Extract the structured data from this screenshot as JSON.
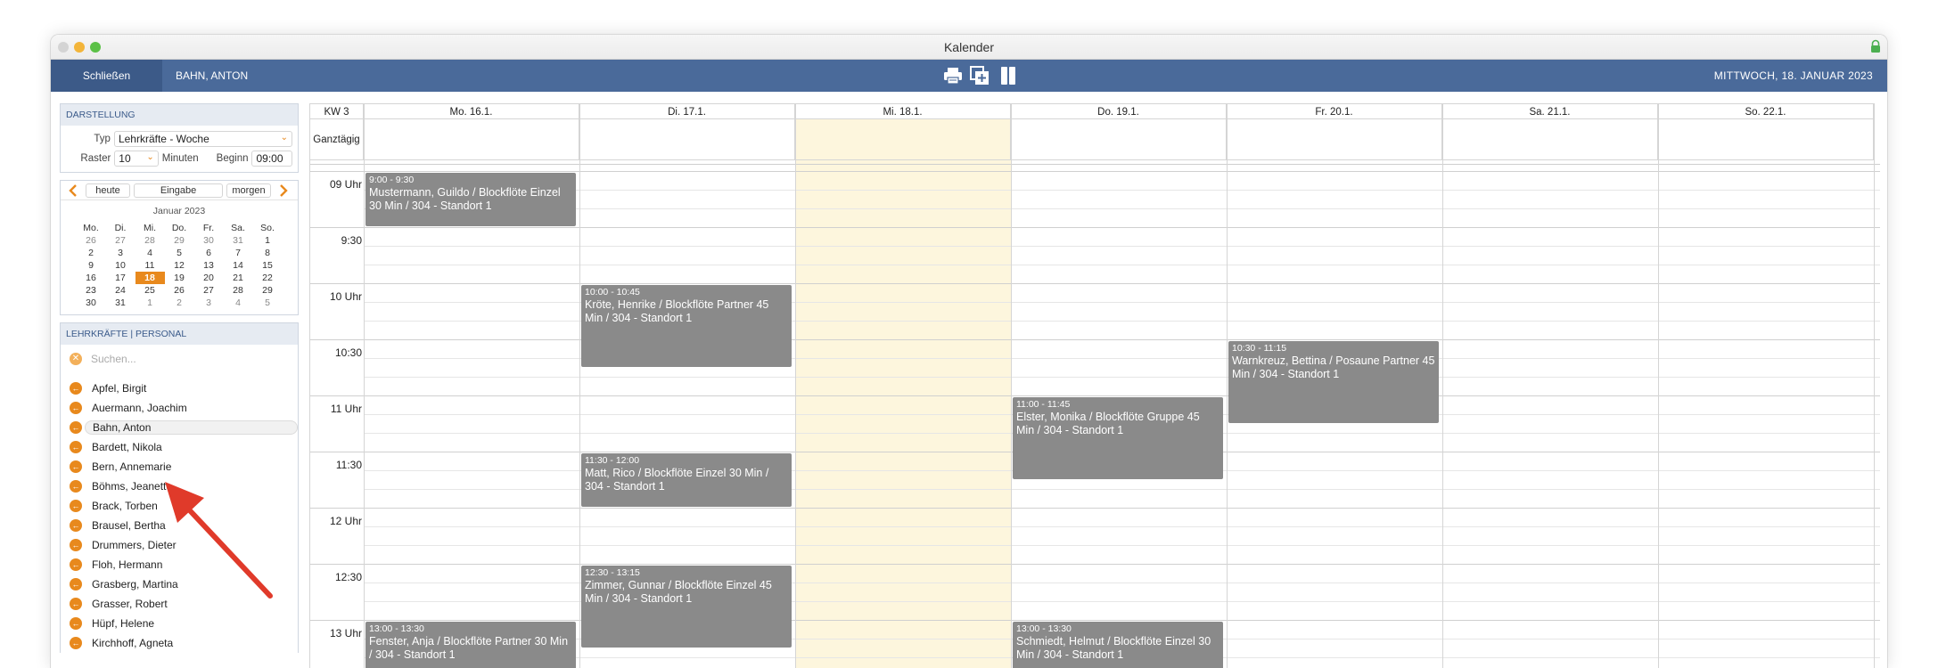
{
  "window": {
    "title": "Kalender"
  },
  "toolbar": {
    "close_label": "Schließen",
    "user_label": "BAHN, ANTON",
    "date_label": "MITTWOCH, 18. JANUAR 2023",
    "icons": [
      "printer-icon",
      "add-copy-icon",
      "columns-icon"
    ]
  },
  "darstellung": {
    "header": "DARSTELLUNG",
    "typ_label": "Typ",
    "typ_value": "Lehrkräfte - Woche",
    "raster_label": "Raster",
    "raster_value": "10",
    "minuten_label": "Minuten",
    "beginn_label": "Beginn",
    "beginn_value": "09:00"
  },
  "nav": {
    "today": "heute",
    "input": "Eingabe",
    "tomorrow": "morgen"
  },
  "mini_calendar": {
    "title": "Januar 2023",
    "weekdays": [
      "Mo.",
      "Di.",
      "Mi.",
      "Do.",
      "Fr.",
      "Sa.",
      "So."
    ],
    "weeks": [
      [
        "26",
        "27",
        "28",
        "29",
        "30",
        "31",
        "1"
      ],
      [
        "2",
        "3",
        "4",
        "5",
        "6",
        "7",
        "8"
      ],
      [
        "9",
        "10",
        "11",
        "12",
        "13",
        "14",
        "15"
      ],
      [
        "16",
        "17",
        "18",
        "19",
        "20",
        "21",
        "22"
      ],
      [
        "23",
        "24",
        "25",
        "26",
        "27",
        "28",
        "29"
      ],
      [
        "30",
        "31",
        "1",
        "2",
        "3",
        "4",
        "5"
      ]
    ],
    "selected": "18"
  },
  "teachers": {
    "header": "LEHRKRÄFTE | PERSONAL",
    "search_placeholder": "Suchen...",
    "items": [
      "Apfel, Birgit",
      "Auermann, Joachim",
      "Bahn, Anton",
      "Bardett, Nikola",
      "Bern, Annemarie",
      "Böhms, Jeanette",
      "Brack, Torben",
      "Brausel, Bertha",
      "Drummers, Dieter",
      "Floh, Hermann",
      "Grasberg, Martina",
      "Grasser, Robert",
      "Hüpf, Helene",
      "Kirchhoff, Agneta"
    ],
    "selected": "Bahn, Anton"
  },
  "calendar": {
    "week_label": "KW 3",
    "allday_label": "Ganztägig",
    "days": [
      "Mo. 16.1.",
      "Di. 17.1.",
      "Mi. 18.1.",
      "Do. 19.1.",
      "Fr. 20.1.",
      "Sa. 21.1.",
      "So. 22.1."
    ],
    "today_index": 2,
    "today_color": "#fdf6dd",
    "time_labels": [
      "09 Uhr",
      "9:30",
      "10 Uhr",
      "10:30",
      "11 Uhr",
      "11:30",
      "12 Uhr",
      "12:30",
      "13 Uhr"
    ],
    "events": [
      {
        "day": 0,
        "time": "9:00 - 9:30",
        "text": "Mustermann, Guildo / Blockflöte Einzel 30 Min / 304 - Standort 1"
      },
      {
        "day": 1,
        "time": "10:00 - 10:45",
        "text": "Kröte, Henrike / Blockflöte Partner 45 Min / 304 - Standort 1"
      },
      {
        "day": 4,
        "time": "10:30 - 11:15",
        "text": "Warnkreuz, Bettina / Posaune Partner 45 Min / 304 - Standort 1"
      },
      {
        "day": 3,
        "time": "11:00 - 11:45",
        "text": "Elster, Monika / Blockflöte Gruppe 45 Min / 304 - Standort 1"
      },
      {
        "day": 1,
        "time": "11:30 - 12:00",
        "text": "Matt, Rico / Blockflöte Einzel 30 Min / 304 - Standort 1"
      },
      {
        "day": 1,
        "time": "12:30 - 13:15",
        "text": "Zimmer, Gunnar / Blockflöte Einzel 45 Min / 304 - Standort 1"
      },
      {
        "day": 0,
        "time": "13:00 - 13:30",
        "text": "Fenster, Anja / Blockflöte Partner 30 Min / 304 - Standort 1"
      },
      {
        "day": 3,
        "time": "13:00 - 13:30",
        "text": "Schmiedt, Helmut / Blockflöte Einzel 30 Min / 304 - Standort 1"
      }
    ],
    "event_color": "#8a8a8a"
  },
  "colors": {
    "toolbar": "#4a6a9a",
    "accent": "#e8891d",
    "arrow": "#e03a2a"
  }
}
